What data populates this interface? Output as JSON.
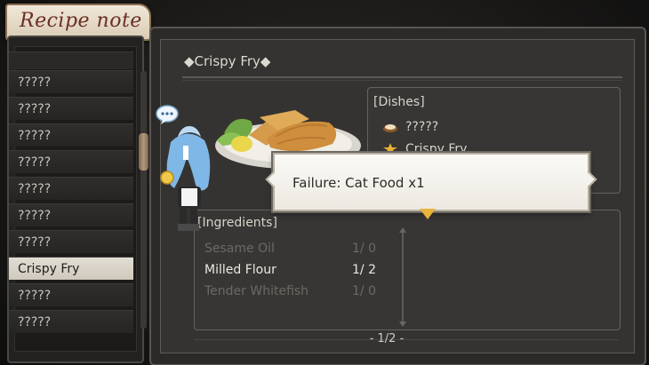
{
  "header": {
    "title": "Recipe note"
  },
  "recipe_list": {
    "items": [
      {
        "label": "?????"
      },
      {
        "label": "?????"
      },
      {
        "label": "?????"
      },
      {
        "label": "?????"
      },
      {
        "label": "?????"
      },
      {
        "label": "?????"
      },
      {
        "label": "?????"
      },
      {
        "label": "Crispy Fry",
        "selected": true
      },
      {
        "label": "?????"
      },
      {
        "label": "?????"
      }
    ]
  },
  "recipe": {
    "title": "◆Crispy Fry◆",
    "dishes_header": "[Dishes]",
    "dishes": [
      {
        "label": "?????",
        "icon": "dish-bowl-icon"
      },
      {
        "label": "Crispy Fry",
        "icon": "star-icon"
      }
    ],
    "ingredients_header": "[Ingredients]",
    "ingredients": [
      {
        "name": "Sesame Oil",
        "qty": "1/ 0",
        "available": false
      },
      {
        "name": "Milled Flour",
        "qty": "1/ 2",
        "available": true
      },
      {
        "name": "Tender Whitefish",
        "qty": "1/ 0",
        "available": false
      }
    ],
    "page_indicator": "- 1/2 -"
  },
  "notification": {
    "text": "Failure: Cat Food x1"
  },
  "colors": {
    "accent": "#e8b43a",
    "selected_bg": "#d8d2c6",
    "title_text": "#6a2f25"
  }
}
